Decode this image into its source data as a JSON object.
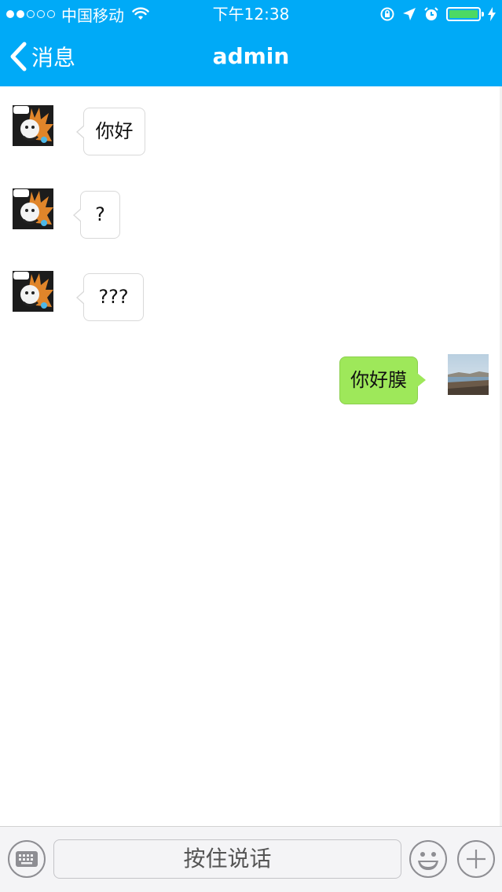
{
  "status_bar": {
    "carrier": "中国移动",
    "time": "下午12:38"
  },
  "nav": {
    "back_label": "消息",
    "title": "admin"
  },
  "messages": [
    {
      "direction": "incoming",
      "text": "你好"
    },
    {
      "direction": "incoming",
      "text": "?"
    },
    {
      "direction": "incoming",
      "text": "???"
    },
    {
      "direction": "outgoing",
      "text": "你好膜"
    }
  ],
  "input_bar": {
    "hold_to_talk_label": "按住说话",
    "left_icon": "keyboard-icon",
    "right_icons": [
      "emoji-icon",
      "plus-icon"
    ]
  },
  "colors": {
    "nav_background": "#00aaf7",
    "outgoing_bubble": "#9ee85a",
    "incoming_bubble": "#ffffff",
    "battery_fill": "#4cd964"
  }
}
